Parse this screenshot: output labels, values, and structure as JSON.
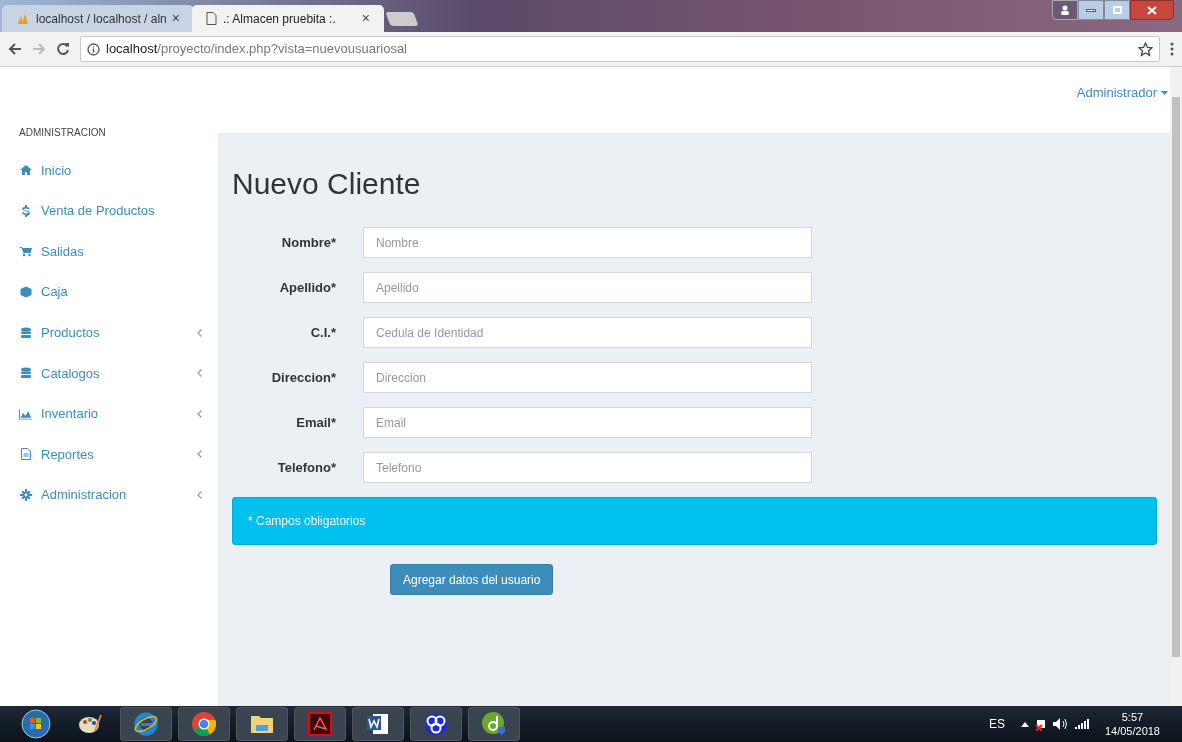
{
  "browser": {
    "tabs": [
      {
        "title": "localhost / localhost / aln",
        "close": "×",
        "selected": false
      },
      {
        "title": ".: Almacen pruebita :.",
        "close": "×",
        "selected": true
      }
    ],
    "url_host": "localhost",
    "url_path": "/proyecto/index.php?vista=nuevousuariosal"
  },
  "topbar": {
    "user": "Administrador"
  },
  "sidebar": {
    "header": "ADMINISTRACION",
    "items": [
      {
        "label": "Inicio",
        "expandable": false
      },
      {
        "label": "Venta de Productos",
        "expandable": false
      },
      {
        "label": "Salidas",
        "expandable": false
      },
      {
        "label": "Caja",
        "expandable": false
      },
      {
        "label": "Productos",
        "expandable": true
      },
      {
        "label": "Catalogos",
        "expandable": true
      },
      {
        "label": "Inventario",
        "expandable": true
      },
      {
        "label": "Reportes",
        "expandable": true
      },
      {
        "label": "Administracion",
        "expandable": true
      }
    ]
  },
  "form": {
    "title": "Nuevo Cliente",
    "fields": [
      {
        "label": "Nombre*",
        "placeholder": "Nombre"
      },
      {
        "label": "Apellido*",
        "placeholder": "Apellido"
      },
      {
        "label": "C.I.*",
        "placeholder": "Cedula de Identidad"
      },
      {
        "label": "Direccion*",
        "placeholder": "Direccion"
      },
      {
        "label": "Email*",
        "placeholder": "Email"
      },
      {
        "label": "Telefono*",
        "placeholder": "Telefono"
      }
    ],
    "notice": "* Campos obligatorios",
    "submit": "Agregar datos del usuario"
  },
  "taskbar": {
    "lang": "ES",
    "time": "5:57",
    "date": "14/05/2018"
  }
}
